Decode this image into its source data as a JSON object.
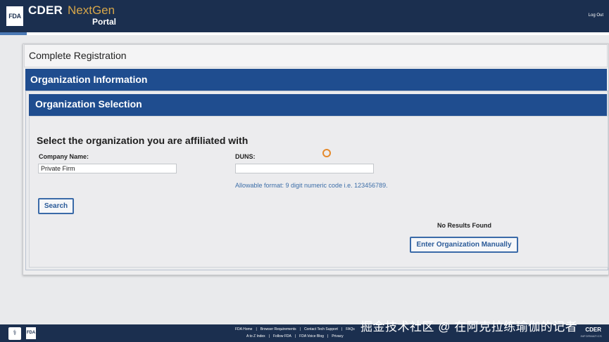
{
  "header": {
    "fda_logo": "FDA",
    "brand_cder": "CDER",
    "brand_nextgen": "NextGen",
    "brand_portal": "Portal",
    "logout_label": "Log Out"
  },
  "page": {
    "title": "Complete Registration",
    "section_title": "Organization Information",
    "subsection_title": "Organization Selection",
    "heading": "Select the organization you are affiliated with"
  },
  "form": {
    "company_label": "Company Name:",
    "company_value": "Private Firm",
    "duns_label": "DUNS:",
    "duns_value": "",
    "duns_hint": "Allowable format: 9 digit numeric code i.e. 123456789.",
    "search_label": "Search"
  },
  "results": {
    "no_results_text": "No Results Found",
    "manual_button_label": "Enter Organization Manually"
  },
  "footer": {
    "hhs_logo": "⚕",
    "fda_logo": "FDA",
    "links_row1": [
      "FDA Home",
      "Browser Requirements",
      "Contact Tech Support",
      "FAQs"
    ],
    "links_row2": [
      "A to Z Index",
      "Follow FDA",
      "FDA Voice Blog",
      "Privacy"
    ],
    "cder_logo": "CDER",
    "cder_sub": "INFORMATICS"
  },
  "watermark": "掘金技术社区 @ 在阿克拉练瑜伽的记者",
  "colors": {
    "header_bg": "#1b2f4f",
    "section_bar": "#1f4d8f",
    "button_border": "#3a6aa8",
    "hint_text": "#3c6ea8",
    "accent_gold": "#d6a64a"
  }
}
